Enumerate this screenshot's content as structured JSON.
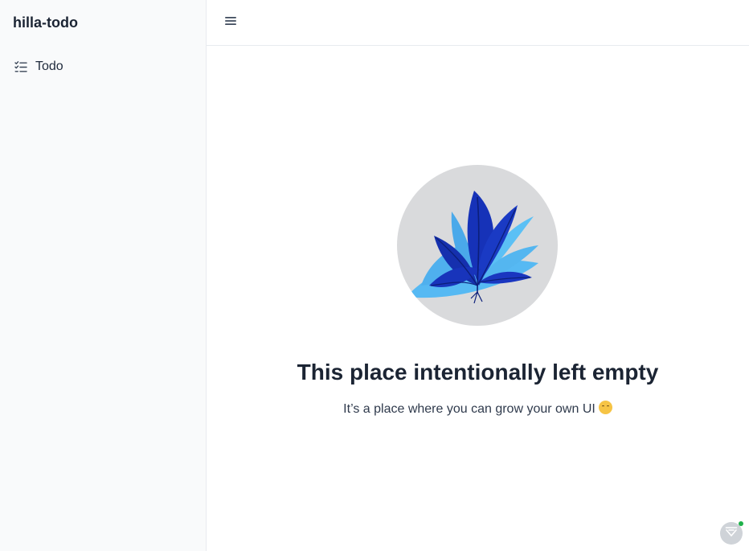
{
  "app": {
    "title": "hilla-todo"
  },
  "sidebar": {
    "items": [
      {
        "label": "Todo",
        "icon": "checklist-icon",
        "active": false
      }
    ]
  },
  "navbar": {
    "menu_icon": "menu-icon"
  },
  "empty_state": {
    "illustration": "plant-icon",
    "title": "This place intentionally left empty",
    "subtitle": "It’s a place where you can grow your own UI",
    "emoji": "hugging-face-emoji"
  },
  "devtools": {
    "icon": "vaadin-devtools-icon",
    "status_color": "#1fb14a"
  },
  "colors": {
    "sidebar_bg": "#f9fafb",
    "leaf_dark": "#1632b8",
    "leaf_light": "#56b9f3",
    "circle_bg": "#d9dadc"
  }
}
